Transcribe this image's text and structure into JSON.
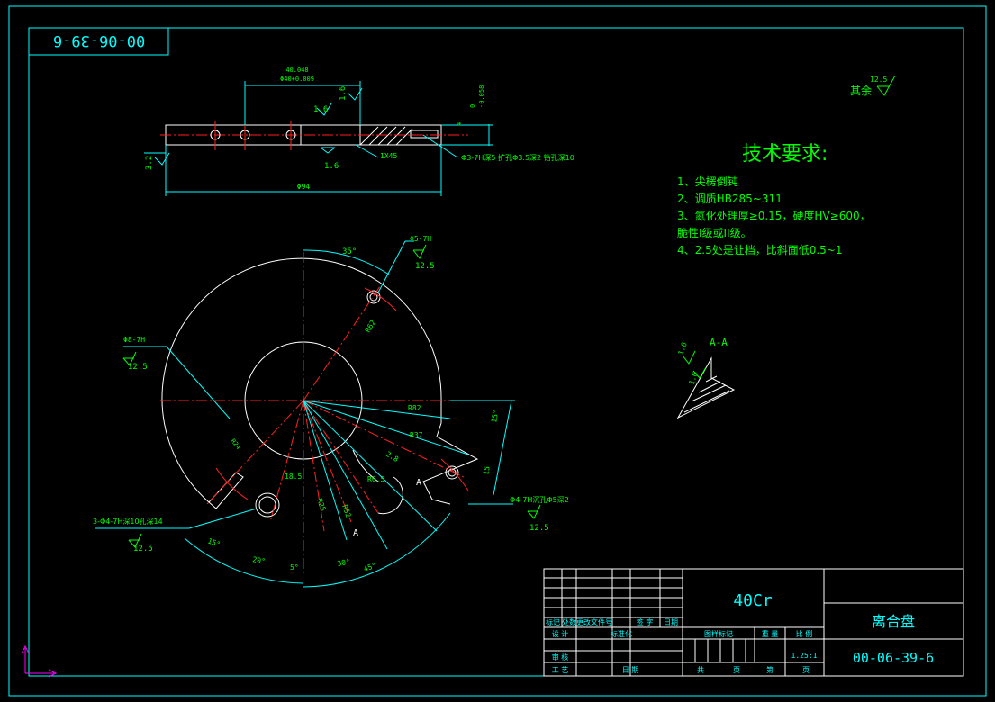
{
  "drawing_no_box": "00-06-39-6",
  "top_view": {
    "dim_width_upper": "40.048",
    "dim_width_lower": "Φ40+0.009",
    "dim_tol_upper": "0",
    "dim_tol_lower": "-0.058",
    "dim_4": "4",
    "rough_1": "1.6",
    "rough_2": "1.6",
    "rough_3": "1.6",
    "rough_left": "3.2",
    "chamfer": "1X45",
    "dim_94": "Φ94",
    "hole_note": "Φ3-7H深5 扩孔Φ3.5深2 钻孔深10"
  },
  "rough_default": {
    "label": "其余",
    "value": "12.5"
  },
  "requirements": {
    "title": "技术要求:",
    "lines": [
      "1、尖楞倒钝",
      "2、调质HB285~311",
      "3、氮化处理厚≥0.15，硬度HV≥600，",
      "脆性I级或II级。",
      "4、2.5处是让档，比斜面低0.5~1"
    ]
  },
  "section": {
    "label": "A-A",
    "angle1": "1.6",
    "angle2": "1.6"
  },
  "front_view": {
    "angle_35": "35°",
    "hole_top_note": "Φ5-7H",
    "hole_top_rough": "12.5",
    "hole_left_note": "Φ8-7H",
    "hole_left_rough": "12.5",
    "r62": "R62",
    "r82": "R82",
    "r37": "R37",
    "r6": "R6.5",
    "r25": "R25",
    "r52": "R52",
    "r_small": "R24",
    "dim_185": "18.5",
    "dim_28": "2.8",
    "dim_15a": "15°",
    "dim_15b": "15",
    "hole_right_note": "Φ4-7H沉孔Φ5深2",
    "hole_right_rough": "12.5",
    "hole_bottom_note": "3-Φ4-7H深10孔深14",
    "hole_bottom_rough": "12.5",
    "angle_15": "15°",
    "angle_20": "20°",
    "angle_5": "5°",
    "angle_30": "30°",
    "angle_45": "45°",
    "sec_a1": "A",
    "sec_a2": "A"
  },
  "title_block": {
    "material": "40Cr",
    "part_name": "离合盘",
    "part_no": "00-06-39-6",
    "scale": "1.25:1",
    "h_labels": [
      "标记",
      "处数",
      "更改文件号",
      "签 字",
      "日期"
    ],
    "design": "设 计",
    "standard": "标准化",
    "review": "审 核",
    "process": "工 艺",
    "date": "日 期",
    "stage_mark": "图样标记",
    "weight": "重 量",
    "ratio": "比 例",
    "total": "共",
    "page": "页",
    "sheet": "第",
    "page2": "页"
  },
  "colors": {
    "frame": "#00ffff",
    "line": "#ffffff",
    "center": "#ff2020",
    "text": "#00ff00",
    "ucs": "#ff00ff"
  }
}
